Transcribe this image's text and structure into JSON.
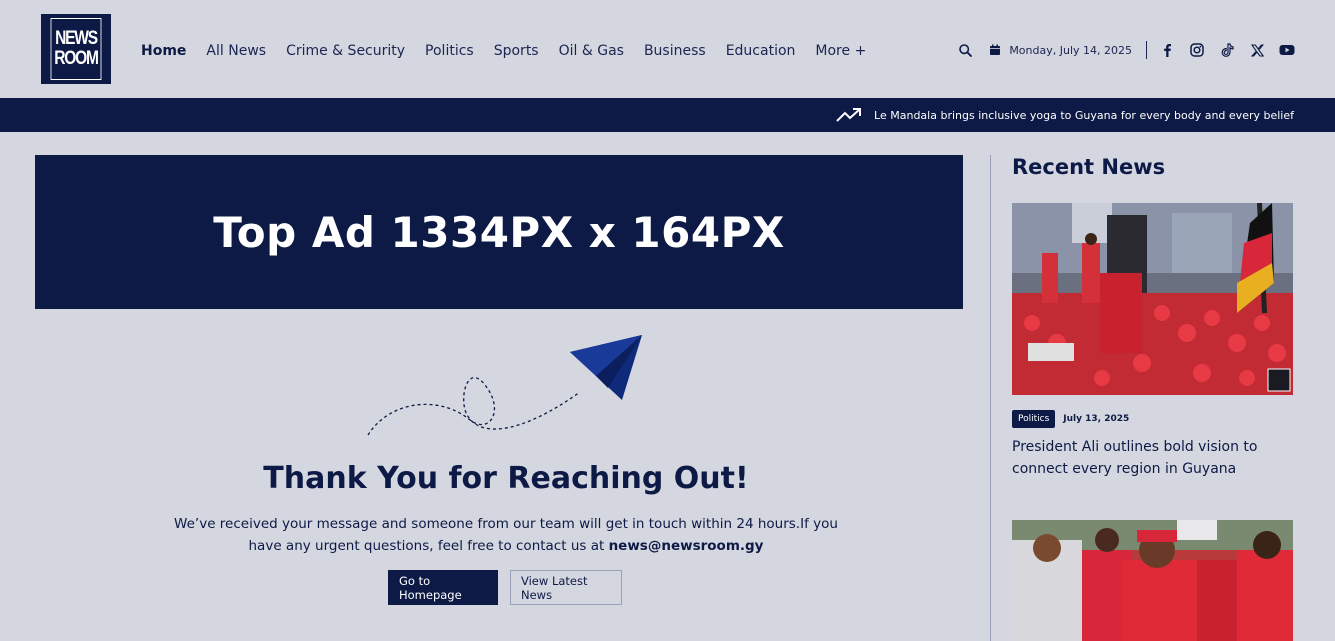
{
  "header": {
    "logo_top": "NEWS",
    "logo_bottom": "ROOM",
    "nav": [
      "Home",
      "All News",
      "Crime & Security",
      "Politics",
      "Sports",
      "Oil & Gas",
      "Business",
      "Education",
      "More +"
    ],
    "date": "Monday, July 14, 2025"
  },
  "ticker": {
    "text": "Le Mandala brings inclusive yoga to Guyana for every body and every belief"
  },
  "ad": {
    "text": "Top Ad 1334PX x 164PX"
  },
  "thanks": {
    "title": "Thank You for Reaching Out!",
    "message_part1": "We’ve received your message and someone from our team will get in touch within 24 hours.If you have any urgent questions, feel free to contact us at ",
    "email": "news@newsroom.gy",
    "home_button": "Go to Homepage",
    "news_button": "View Latest News"
  },
  "sidebar": {
    "title": "Recent News",
    "items": [
      {
        "category": "Politics",
        "date": "July 13, 2025",
        "title": "President Ali outlines bold vision to connect every region in Guyana"
      }
    ]
  },
  "colors": {
    "navy": "#0d1a45",
    "background": "#d4d7e0",
    "accent_red": "#d8263a"
  }
}
